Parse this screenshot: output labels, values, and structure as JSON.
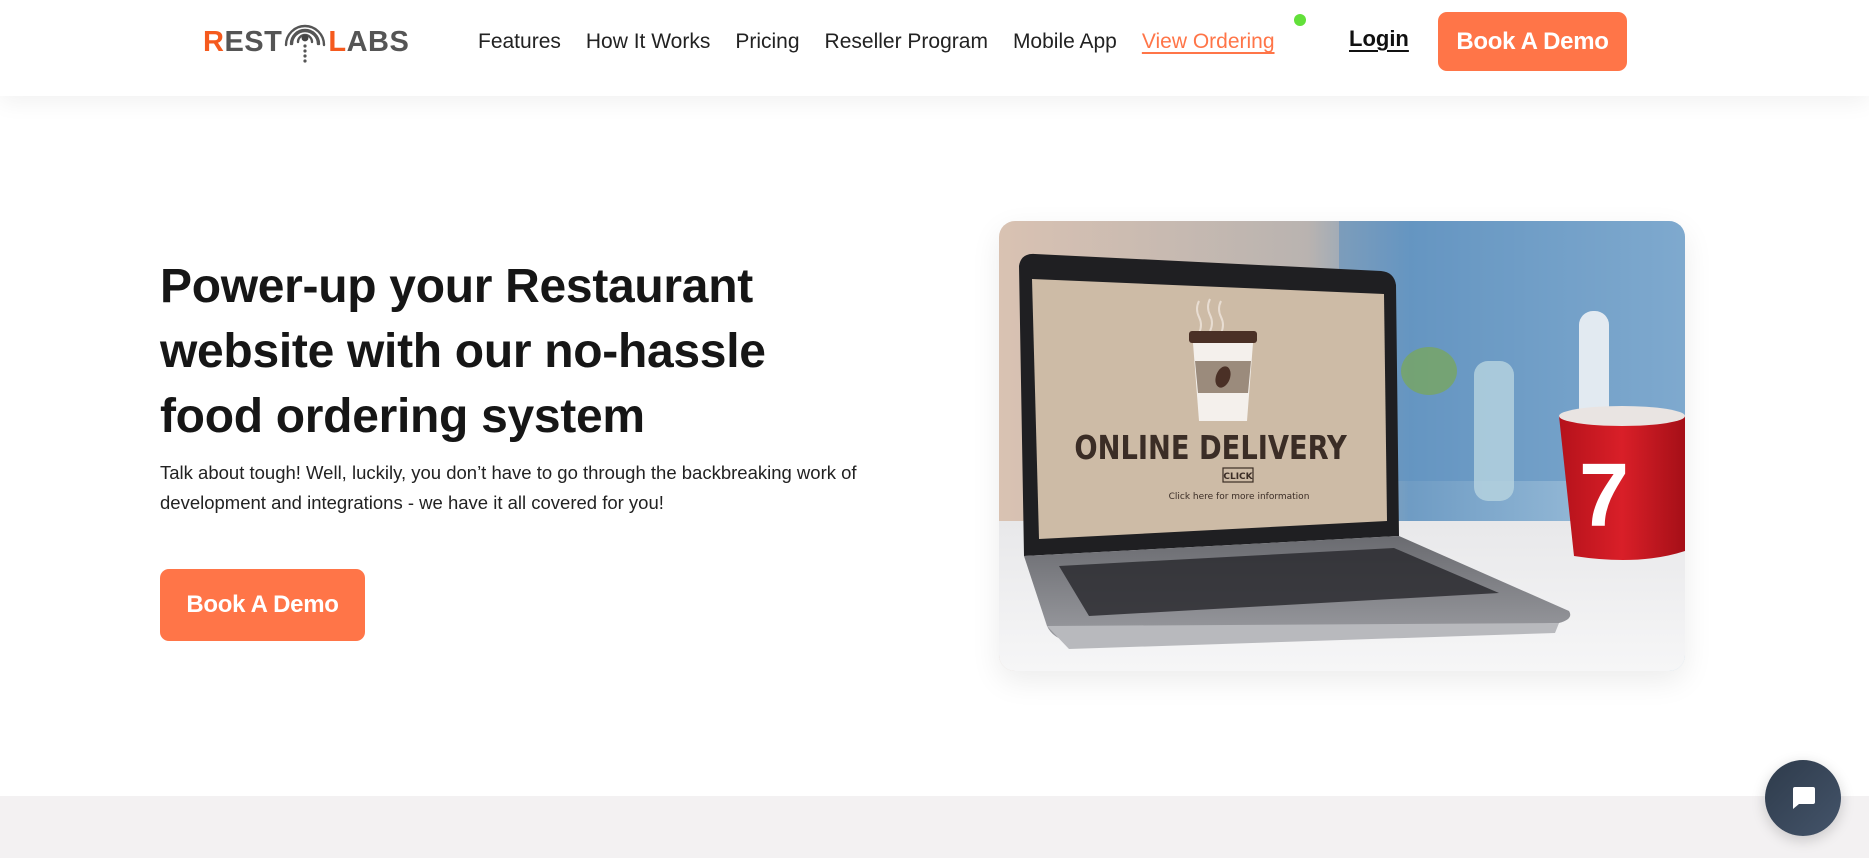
{
  "brand": {
    "name_left": "REST",
    "name_right": "LABS",
    "logo_icon": "signal-antenna-icon",
    "accent_color": "#F55A1E",
    "primary_color": "#FF7548"
  },
  "nav": {
    "items": [
      {
        "label": "Features"
      },
      {
        "label": "How It Works"
      },
      {
        "label": "Pricing"
      },
      {
        "label": "Reseller Program"
      },
      {
        "label": "Mobile App"
      },
      {
        "label": "View Ordering",
        "active": true
      }
    ],
    "status_dot_color": "#62E03A",
    "login_label": "Login",
    "cta_label": "Book A Demo"
  },
  "hero": {
    "title": "Power-up your Restaurant website with our no-hassle food ordering system",
    "description": "Talk about tough! Well, luckily, you don’t have to go through the backbreaking work of development and integrations - we have it all covered for you!",
    "cta_label": "Book A Demo",
    "image": {
      "alt": "Laptop showing online delivery screen next to a red mug",
      "screen_heading": "ONLINE DELIVERY",
      "screen_button": "CLICK",
      "screen_caption": "Click here for more information",
      "mug_number": "7"
    }
  },
  "chat": {
    "icon": "chat-bubble-icon"
  }
}
